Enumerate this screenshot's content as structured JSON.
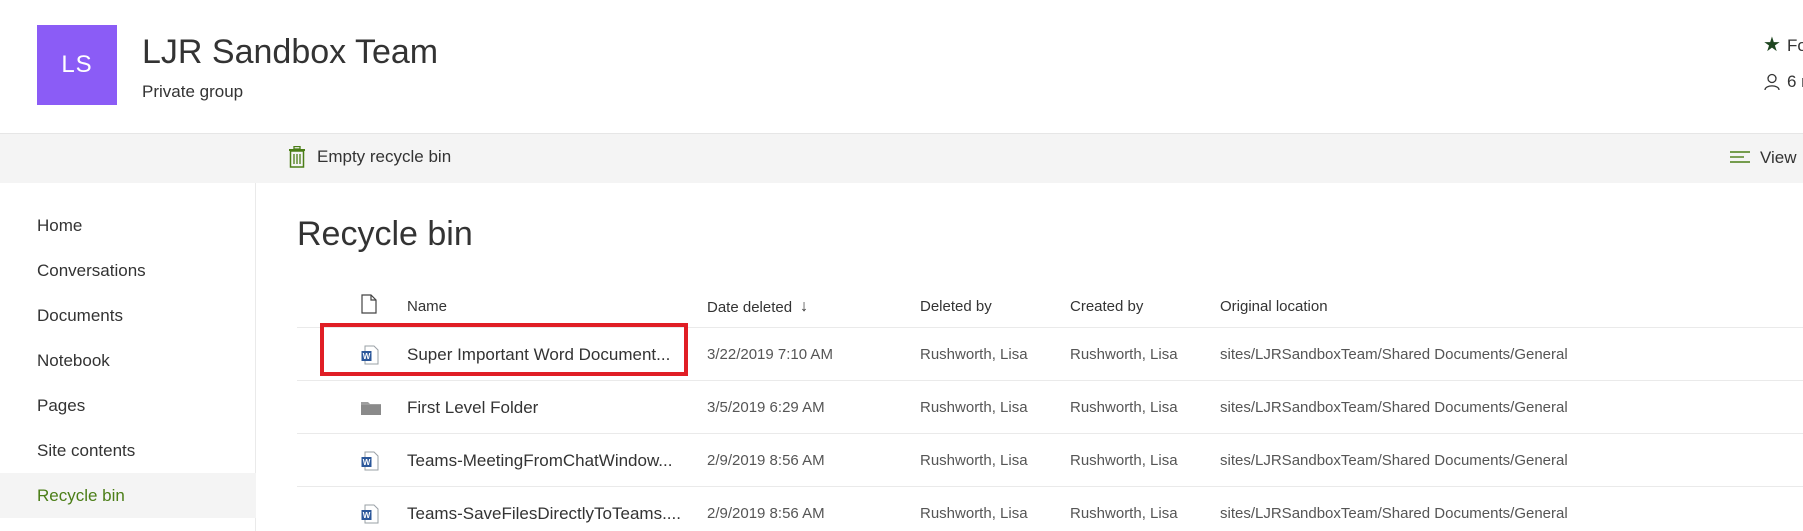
{
  "site": {
    "logo_initials": "LS",
    "title": "LJR Sandbox Team",
    "subtitle": "Private group",
    "follow_label": "Fo",
    "members_label": "6 m"
  },
  "command_bar": {
    "empty_label": "Empty recycle bin",
    "view_label": "View"
  },
  "nav": {
    "items": [
      {
        "label": "Home"
      },
      {
        "label": "Conversations"
      },
      {
        "label": "Documents"
      },
      {
        "label": "Notebook"
      },
      {
        "label": "Pages"
      },
      {
        "label": "Site contents"
      },
      {
        "label": "Recycle bin"
      }
    ]
  },
  "main": {
    "title": "Recycle bin",
    "columns": {
      "name": "Name",
      "date_deleted": "Date deleted",
      "deleted_by": "Deleted by",
      "created_by": "Created by",
      "original_location": "Original location"
    },
    "rows": [
      {
        "type": "word-icon",
        "name": "Super Important Word Document...",
        "date_deleted": "3/22/2019 7:10 AM",
        "deleted_by": "Rushworth, Lisa",
        "created_by": "Rushworth, Lisa",
        "location": "sites/LJRSandboxTeam/Shared Documents/General"
      },
      {
        "type": "folder-icon",
        "name": "First Level Folder",
        "date_deleted": "3/5/2019 6:29 AM",
        "deleted_by": "Rushworth, Lisa",
        "created_by": "Rushworth, Lisa",
        "location": "sites/LJRSandboxTeam/Shared Documents/General"
      },
      {
        "type": "word-icon",
        "name": "Teams-MeetingFromChatWindow...",
        "date_deleted": "2/9/2019 8:56 AM",
        "deleted_by": "Rushworth, Lisa",
        "created_by": "Rushworth, Lisa",
        "location": "sites/LJRSandboxTeam/Shared Documents/General"
      },
      {
        "type": "word-icon",
        "name": "Teams-SaveFilesDirectlyToTeams....",
        "date_deleted": "2/9/2019 8:56 AM",
        "deleted_by": "Rushworth, Lisa",
        "created_by": "Rushworth, Lisa",
        "location": "sites/LJRSandboxTeam/Shared Documents/General"
      }
    ]
  },
  "colors": {
    "logo": "#8b5cf6",
    "accent_green": "#4b7e17",
    "highlight_red": "#e01e25"
  }
}
